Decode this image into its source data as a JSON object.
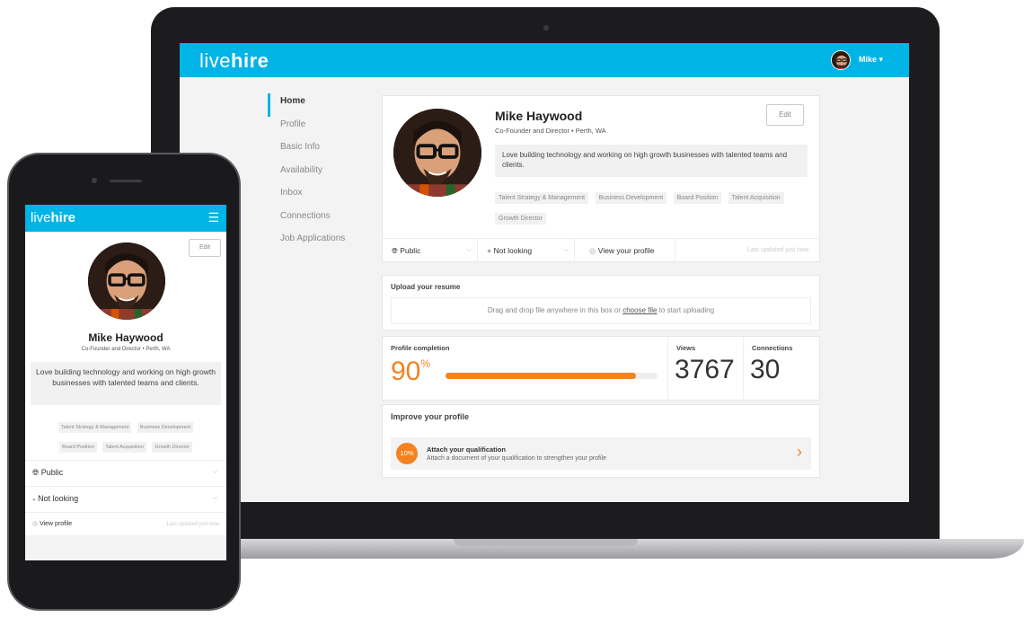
{
  "colors": {
    "brand": "#00b4e6",
    "accent": "#f58220"
  },
  "desktop": {
    "logo_light": "live",
    "logo_bold": "hire",
    "user_name": "Mike",
    "user_caret": "▾",
    "nav": [
      "Home",
      "Profile",
      "Basic Info",
      "Availability",
      "Inbox",
      "Connections",
      "Job Applications"
    ],
    "profile": {
      "name": "Mike Haywood",
      "role": "Co-Founder and Director • Perth, WA",
      "bio": "Love building technology and working on high growth businesses with talented teams and clients.",
      "tags": [
        "Talent Strategy & Management",
        "Business Development",
        "Board Position",
        "Talent Acquisition",
        "Growth Director"
      ],
      "edit_label": "Edit"
    },
    "status": {
      "visibility": "Public",
      "availability": "Not looking",
      "view_profile": "View your profile",
      "last_updated": "Last updated just now"
    },
    "upload": {
      "title": "Upload your resume",
      "text_before": "Drag and drop file anywhere in this box or ",
      "link": "choose file",
      "text_after": " to start uploading"
    },
    "stats": {
      "completion_label": "Profile completion",
      "completion_value": "90",
      "completion_unit": "%",
      "completion_fraction": 0.9,
      "views_label": "Views",
      "views_value": "3767",
      "connections_label": "Connections",
      "connections_value": "30"
    },
    "improve": {
      "title": "Improve your profile",
      "badge": "10%",
      "item_title": "Attach your qualification",
      "item_sub": "Attach a document of your qualification to strengthen your profile",
      "icon": "chevron-right-icon"
    }
  },
  "mobile": {
    "logo_light": "live",
    "logo_bold": "hire",
    "edit_label": "Edit",
    "name": "Mike Haywood",
    "role": "Co-Founder and Director • Perth, WA",
    "bio": "Love building technology and working on high growth businesses with talented teams and clients.",
    "tags": [
      "Talent Strategy & Management",
      "Business Development",
      "Board Position",
      "Talent Acquisition",
      "Growth Director"
    ],
    "visibility": "Public",
    "availability": "Not looking",
    "view_profile": "View profile",
    "last_updated": "Last updated just now"
  }
}
